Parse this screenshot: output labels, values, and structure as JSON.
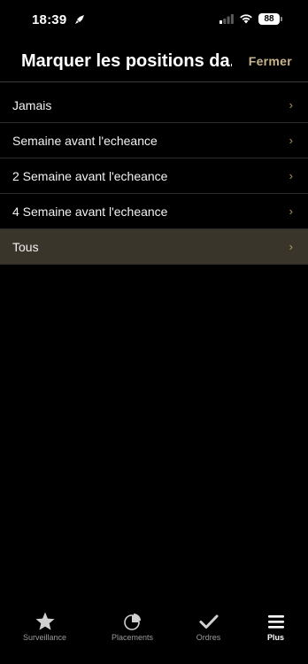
{
  "status_bar": {
    "time": "18:39",
    "battery": "88",
    "icons": [
      "rocket-icon",
      "signal-icon",
      "wifi-icon",
      "battery-icon"
    ]
  },
  "header": {
    "title": "Marquer les positions da...",
    "close_label": "Fermer"
  },
  "options": [
    {
      "label": "Jamais",
      "selected": false
    },
    {
      "label": "Semaine avant l'echeance",
      "selected": false
    },
    {
      "label": "2 Semaine avant l'echeance",
      "selected": false
    },
    {
      "label": "4 Semaine avant l'echeance",
      "selected": false
    },
    {
      "label": "Tous",
      "selected": true
    }
  ],
  "chevron": "›",
  "tab_bar": {
    "tabs": [
      {
        "label": "Surveillance",
        "icon": "star-icon",
        "active": false
      },
      {
        "label": "Placements",
        "icon": "pie-chart-icon",
        "active": false
      },
      {
        "label": "Ordres",
        "icon": "checkmark-icon",
        "active": false
      },
      {
        "label": "Plus",
        "icon": "menu-icon",
        "active": true
      }
    ]
  },
  "colors": {
    "background": "#000000",
    "accent_gold": "#c9b58b",
    "selected_row": "#39352b",
    "separator": "#2a2a2c"
  }
}
